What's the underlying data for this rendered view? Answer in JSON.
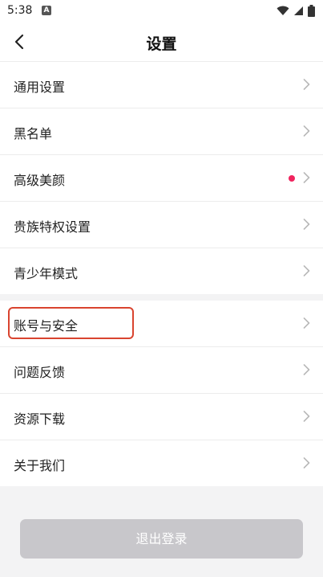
{
  "status_bar": {
    "time": "5:38",
    "notification_icon": "a-notification-icon",
    "wifi_icon": "wifi-icon",
    "signal_icon": "signal-icon",
    "battery_icon": "battery-icon"
  },
  "header": {
    "back_icon": "back-chevron-icon",
    "title": "设置"
  },
  "group1": {
    "items": [
      {
        "label": "通用设置",
        "has_dot": false
      },
      {
        "label": "黑名单",
        "has_dot": false
      },
      {
        "label": "高级美颜",
        "has_dot": true,
        "dot_color": "#f0245e"
      },
      {
        "label": "贵族特权设置",
        "has_dot": false
      },
      {
        "label": "青少年模式",
        "has_dot": false
      }
    ]
  },
  "group2": {
    "items": [
      {
        "label": "账号与安全",
        "highlighted": true,
        "highlight_color": "#d9442f"
      },
      {
        "label": "问题反馈"
      },
      {
        "label": "资源下载"
      },
      {
        "label": "关于我们"
      }
    ]
  },
  "logout": {
    "label": "退出登录",
    "bg_color": "#c8c7cb"
  }
}
